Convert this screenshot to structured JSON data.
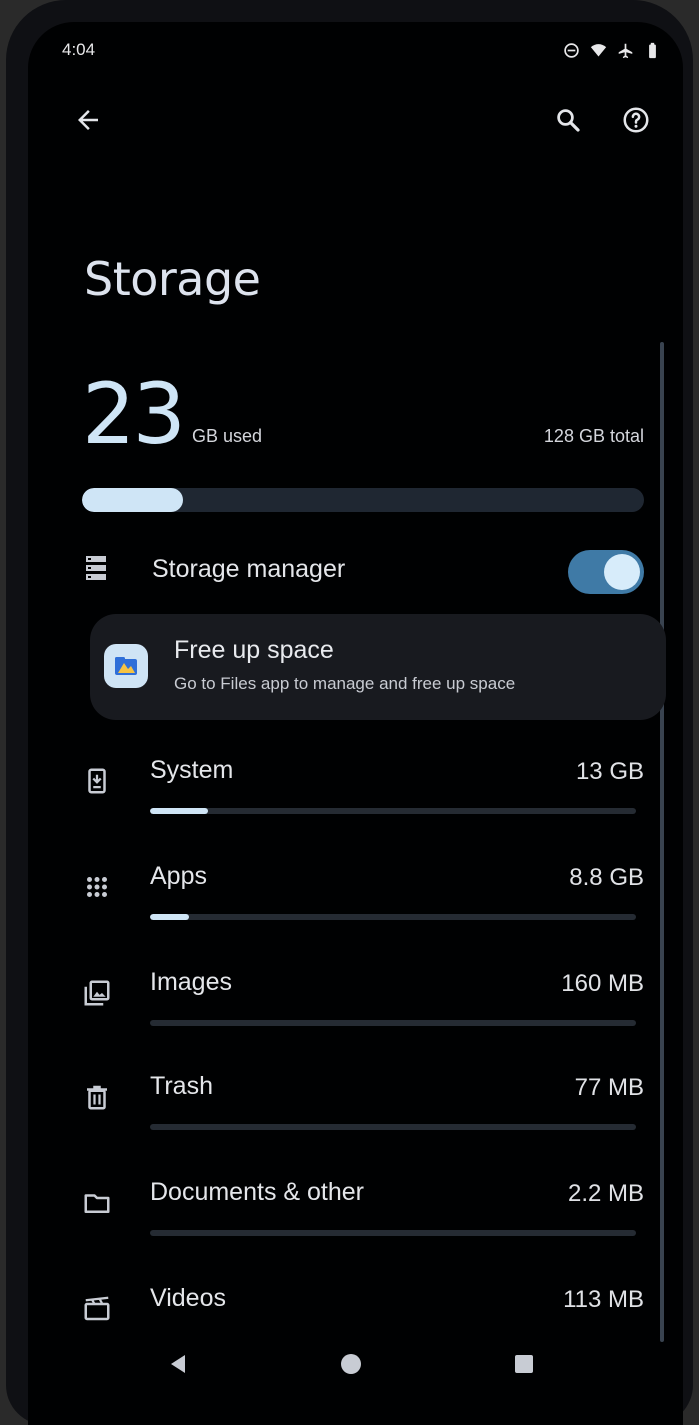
{
  "status": {
    "time": "4:04",
    "icons": [
      "do-not-disturb-icon",
      "wifi-icon",
      "airplane-icon",
      "battery-icon"
    ]
  },
  "header": {
    "back_icon": "arrow-back-icon",
    "search_icon": "search-icon",
    "help_icon": "help-icon"
  },
  "page": {
    "title": "Storage"
  },
  "usage": {
    "used_value": "23",
    "used_unit": "GB used",
    "total": "128 GB total",
    "used_fraction": 0.18
  },
  "storage_manager": {
    "label": "Storage manager",
    "enabled": true
  },
  "free_up": {
    "title": "Free up space",
    "subtitle": "Go to Files app to manage and free up space"
  },
  "categories": [
    {
      "label": "System",
      "size": "13 GB",
      "fraction": 0.12,
      "icon": "system-icon"
    },
    {
      "label": "Apps",
      "size": "8.8 GB",
      "fraction": 0.08,
      "icon": "apps-grid-icon"
    },
    {
      "label": "Images",
      "size": "160 MB",
      "fraction": 0.0,
      "icon": "images-icon"
    },
    {
      "label": "Trash",
      "size": "77 MB",
      "fraction": 0.0,
      "icon": "trash-icon"
    },
    {
      "label": "Documents & other",
      "size": "2.2 MB",
      "fraction": 0.0,
      "icon": "folder-icon"
    },
    {
      "label": "Videos",
      "size": "113 MB",
      "fraction": 0.0,
      "icon": "videos-icon"
    }
  ],
  "nav": {
    "back": "nav-back-icon",
    "home": "nav-home-icon",
    "recents": "nav-recents-icon"
  },
  "colors": {
    "accent": "#cfe5f6",
    "toggle_on": "#3f7aa6",
    "background": "#000102"
  }
}
